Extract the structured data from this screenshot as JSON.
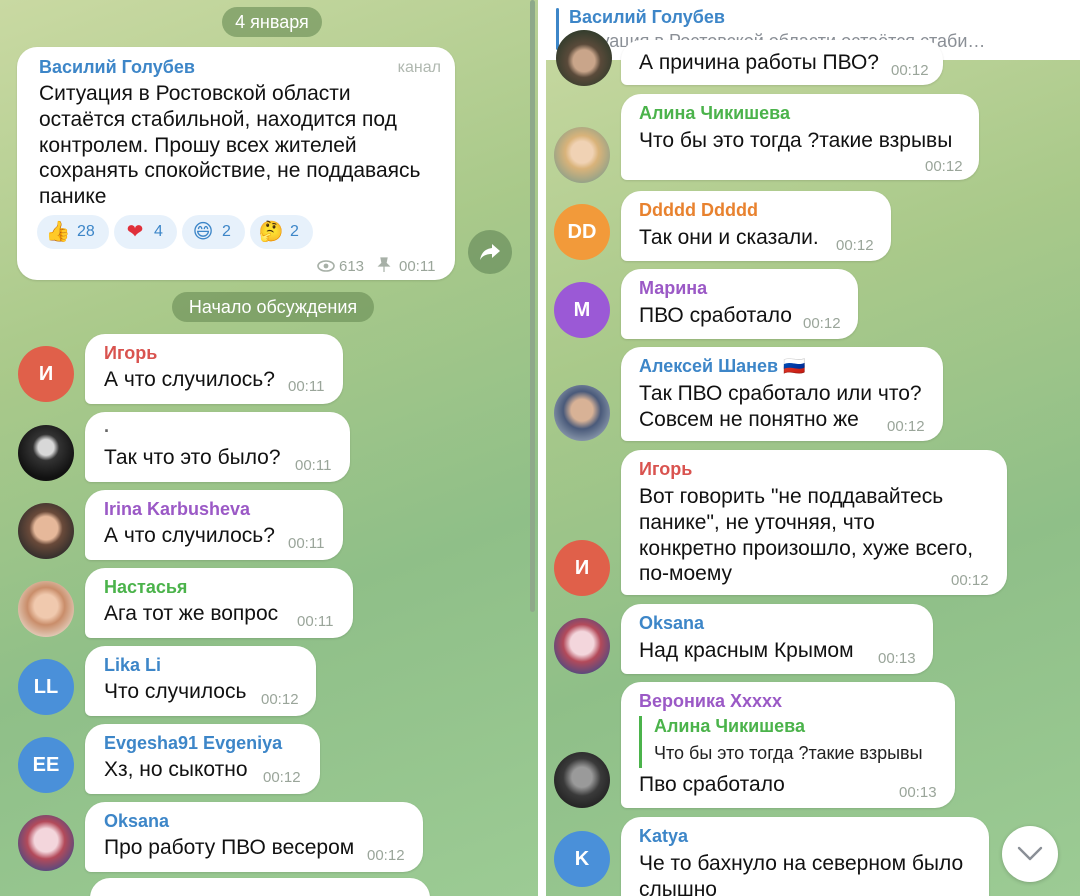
{
  "left": {
    "date_pill": "4 января",
    "post": {
      "author": "Василий Голубев",
      "badge": "канал",
      "lines": [
        "Ситуация в Ростовской области",
        "остаётся стабильной, находится под",
        "контролем. Прошу всех жителей",
        "сохранять спокойствие, не поддаваясь",
        "панике"
      ],
      "reactions": [
        {
          "emoji": "👍",
          "count": "28"
        },
        {
          "emoji": "❤",
          "count": "4"
        },
        {
          "emoji": "😄",
          "count": "2"
        },
        {
          "emoji": "🤔",
          "count": "2"
        }
      ],
      "views": "613",
      "time": "00:11"
    },
    "discussion_pill": "Начало обсуждения",
    "messages": [
      {
        "name": "Игорь",
        "avatar": "И",
        "text": "А что случилось?",
        "time": "00:11"
      },
      {
        "name": ".",
        "avatar": "",
        "text": "Так что это было?",
        "time": "00:11"
      },
      {
        "name": "Irina Karbusheva",
        "avatar": "",
        "text": "А что случилось?",
        "time": "00:11"
      },
      {
        "name": "Настасья",
        "avatar": "",
        "text": "Ага тот же вопрос",
        "time": "00:11"
      },
      {
        "name": "Lika Li",
        "avatar": "LL",
        "text": "Что случилось",
        "time": "00:12"
      },
      {
        "name": "Evgesha91 Evgeniya",
        "avatar": "EE",
        "text": "Хз, но сыкотно",
        "time": "00:12"
      },
      {
        "name": "Oksana",
        "avatar": "",
        "text": "Про работу ПВО весером",
        "time": "00:12"
      }
    ]
  },
  "right": {
    "pinned": {
      "title": "Василий Голубев",
      "text": "Ситуация в Ростовской области остаётся стаби…"
    },
    "partial_message": {
      "text": "А причина работы ПВО?",
      "time": "00:12"
    },
    "messages": [
      {
        "name": "Алина Чикишева",
        "avatar": "",
        "lines": [
          "Что бы это тогда ?такие взрывы"
        ],
        "time": "00:12"
      },
      {
        "name": "Ddddd Ddddd",
        "avatar": "DD",
        "lines": [
          "Так они и сказали."
        ],
        "time": "00:12"
      },
      {
        "name": "Марина",
        "avatar": "M",
        "lines": [
          "ПВО сработало"
        ],
        "time": "00:12"
      },
      {
        "name": "Алексей Шанев 🇷🇺",
        "avatar": "",
        "lines": [
          "Так ПВО сработало или что?",
          "Совсем не понятно же"
        ],
        "time": "00:12"
      },
      {
        "name": "Игорь",
        "avatar": "И",
        "lines": [
          "Вот говорить \"не поддавайтесь",
          "панике\", не уточняя, что",
          "конкретно произошло, хуже всего,",
          "по-моему"
        ],
        "time": "00:12"
      },
      {
        "name": "Oksana",
        "avatar": "",
        "lines": [
          "Над красным Крымом"
        ],
        "time": "00:13"
      },
      {
        "name": "Вероника Xxxxx",
        "avatar": "",
        "quote_name": "Алина Чикишева",
        "quote_text": "Что бы это тогда ?такие взрывы",
        "lines": [
          "Пво сработало"
        ],
        "time": "00:13"
      },
      {
        "name": "Katya",
        "avatar": "K",
        "lines": [
          "Че то бахнуло на северном было",
          "слышно"
        ],
        "time": ""
      }
    ]
  },
  "colors": {
    "red": "#e0604a",
    "orange": "#f29a3a",
    "purple": "#9b59d6",
    "blue": "#4a90d9",
    "name_blue": "#3d86c8",
    "name_green": "#4bb34b",
    "name_purple": "#9b59c6",
    "name_orange": "#e8822f",
    "name_red": "#d9534f"
  }
}
